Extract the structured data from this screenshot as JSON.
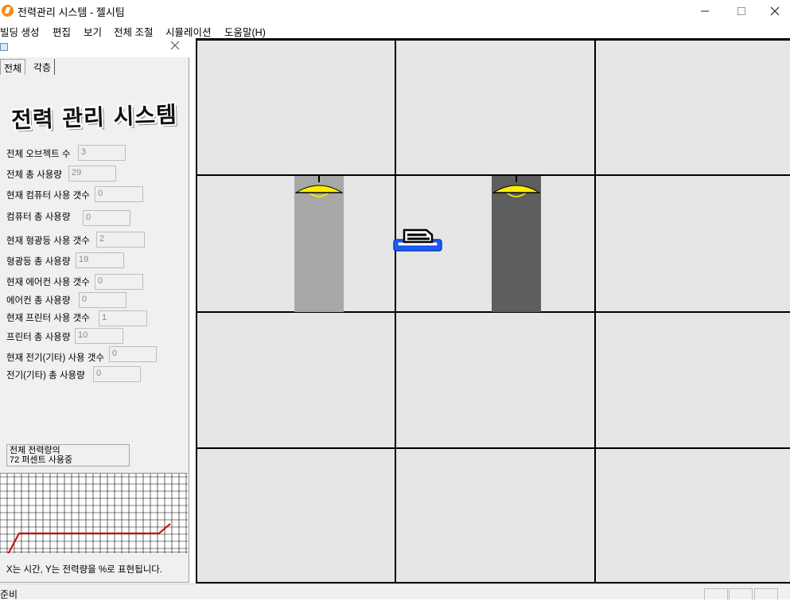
{
  "window": {
    "title": "전력관리 시스템 - 젤시팀",
    "minimize_icon": "minimize-icon",
    "maximize_icon": "maximize-icon",
    "close_icon": "close-icon"
  },
  "menu": {
    "items": [
      "빌딩 생성",
      "편집",
      "보기",
      "전체 조절",
      "시뮬레이션",
      "도움말(H)"
    ]
  },
  "panel": {
    "tabs": [
      "전체",
      "각층"
    ],
    "logo_text": "전력 관리 시스템",
    "stats": [
      {
        "label": "전체 오브젝트 수",
        "value": "3"
      },
      {
        "label": "전체 총 사용량",
        "value": "29"
      },
      {
        "label": "현재 컴퓨터 사용 갯수",
        "value": "0"
      },
      {
        "label": "컴퓨터 총 사용량",
        "value": "0"
      },
      {
        "label": "현재 형광등 사용 갯수",
        "value": "2"
      },
      {
        "label": "형광등 총 사용량",
        "value": "19"
      },
      {
        "label": "현재 에어컨 사용 갯수",
        "value": "0"
      },
      {
        "label": "에어컨 총 사용량",
        "value": "0"
      },
      {
        "label": "현재 프린터 사용 갯수",
        "value": "1"
      },
      {
        "label": "프린터 총 사용량",
        "value": "10"
      },
      {
        "label": "현재 전기(기타) 사용 갯수",
        "value": "0"
      },
      {
        "label": "전기(기타) 총 사용량",
        "value": "0"
      }
    ],
    "summary_line1": "전체 전력량의",
    "summary_line2": "72 퍼센트 사용중",
    "graph_caption": "X는 시간, Y는 전력량을 %로 표현됩니다.",
    "graph_color": "#cc0000",
    "graph_values": [
      10,
      40,
      40,
      40,
      40,
      40,
      40,
      40,
      40,
      40,
      48
    ]
  },
  "simulation": {
    "lamp_color": "#ffee00",
    "beam_colors": [
      "#a8a8a8",
      "#5e5e5e"
    ],
    "printer_color": "#1a5cff"
  },
  "status": {
    "text": "준비"
  }
}
